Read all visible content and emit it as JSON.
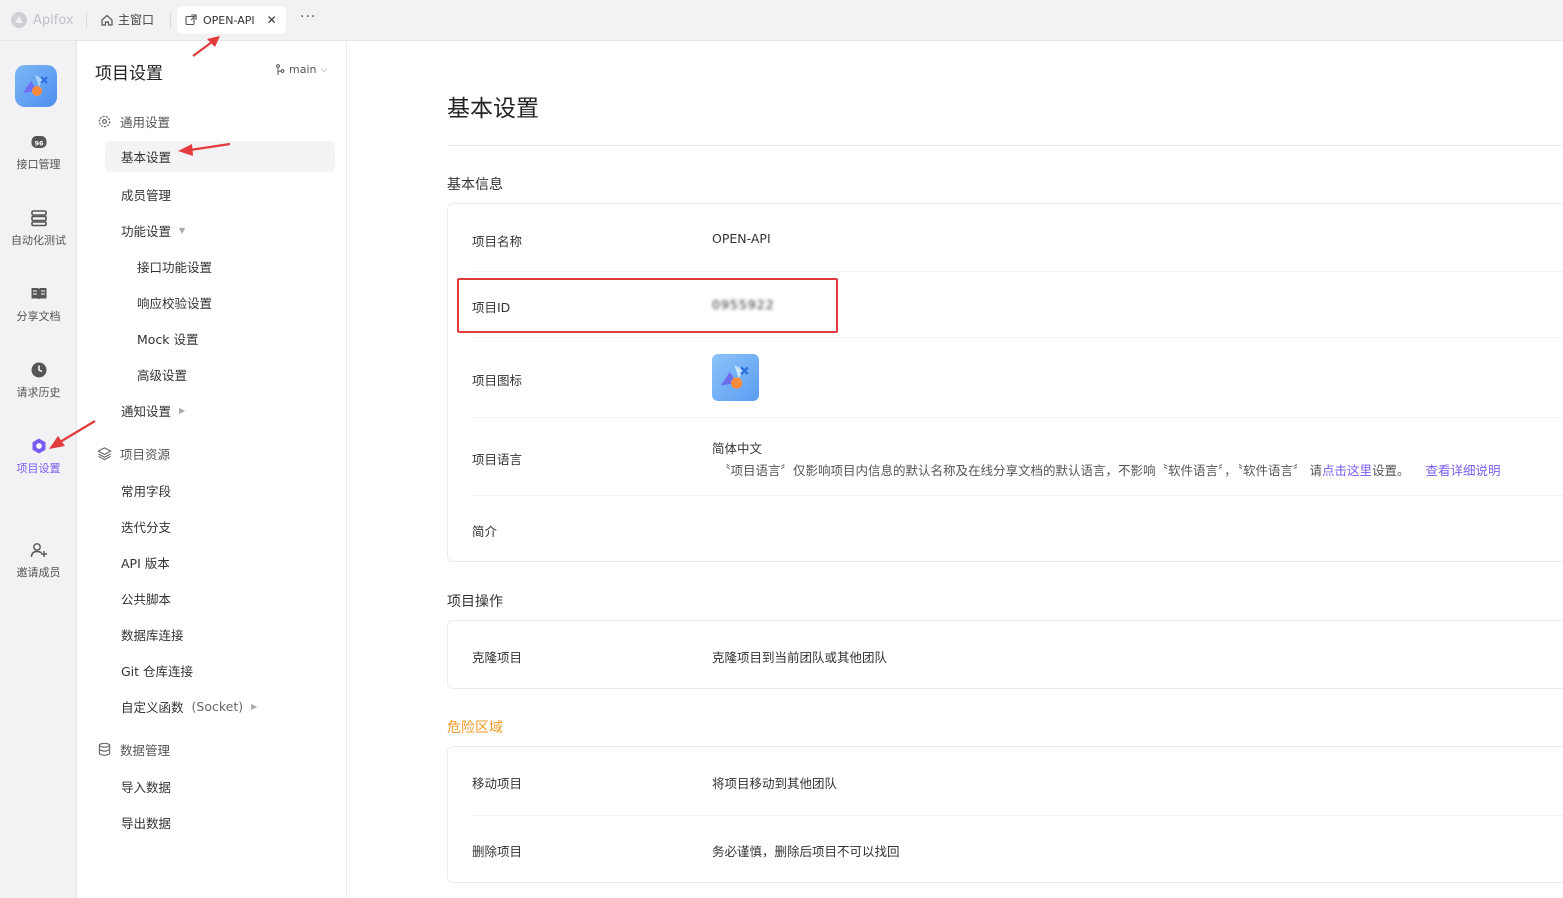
{
  "titlebar": {
    "brand": "Apifox",
    "home_tab": "主窗口",
    "open_tab": "OPEN-API",
    "close_glyph": "✕",
    "more": "···"
  },
  "rail": {
    "items": [
      {
        "label": "接口管理",
        "icon": "api-icon"
      },
      {
        "label": "自动化测试",
        "icon": "automation-icon"
      },
      {
        "label": "分享文档",
        "icon": "book-icon"
      },
      {
        "label": "请求历史",
        "icon": "clock-icon"
      },
      {
        "label": "项目设置",
        "icon": "settings-hex-icon",
        "active": true
      },
      {
        "label": "邀请成员",
        "icon": "add-user-icon"
      }
    ]
  },
  "nav": {
    "title": "项目设置",
    "branch": "main",
    "general": {
      "label": "通用设置",
      "items": [
        "基本设置",
        "成员管理",
        "功能设置"
      ],
      "feature_sub": [
        "接口功能设置",
        "响应校验设置",
        "Mock 设置",
        "高级设置"
      ],
      "notify": "通知设置"
    },
    "resources": {
      "label": "项目资源",
      "items": [
        "常用字段",
        "迭代分支",
        "API 版本",
        "公共脚本",
        "数据库连接",
        "Git 仓库连接"
      ],
      "custom_fn": "自定义函数",
      "custom_fn_suffix": "(Socket)"
    },
    "data": {
      "label": "数据管理",
      "items": [
        "导入数据",
        "导出数据"
      ]
    }
  },
  "main": {
    "title": "基本设置",
    "basic_info": {
      "label": "基本信息",
      "name_key": "项目名称",
      "name_value": "OPEN-API",
      "id_key": "项目ID",
      "id_value": "0955922",
      "icon_key": "项目图标",
      "lang_key": "项目语言",
      "lang_value": "简体中文",
      "lang_note_a": "〝项目语言〞仅影响项目内信息的默认名称及在线分享文档的默认语言，不影响〝软件语言〞，〝软件语言〞 请",
      "lang_note_link": "点击这里",
      "lang_note_b": "设置。",
      "lang_detail": "查看详细说明",
      "intro_key": "简介"
    },
    "ops": {
      "label": "项目操作",
      "clone_key": "克隆项目",
      "clone_value": "克隆项目到当前团队或其他团队"
    },
    "danger": {
      "label": "危险区域",
      "color": "#f29b2a",
      "move_key": "移动项目",
      "move_value": "将项目移动到其他团队",
      "delete_key": "删除项目",
      "delete_value": "务必谨慎，删除后项目不可以找回"
    }
  },
  "accent": "#7a5cf0",
  "annotation_color": "#e23b3b"
}
